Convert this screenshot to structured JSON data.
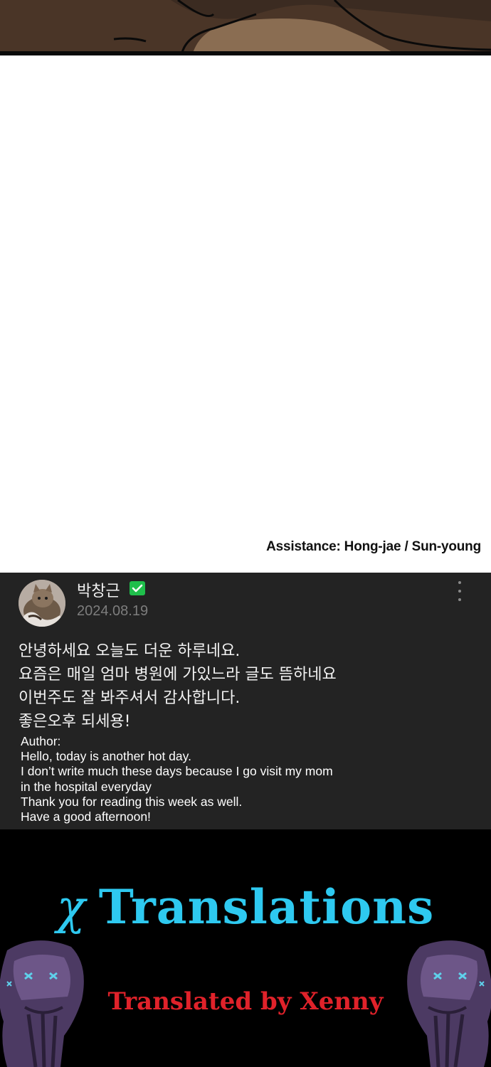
{
  "credits": {
    "text": "Assistance: Hong-jae / Sun-young"
  },
  "comment": {
    "author": "박창근",
    "date": "2024.08.19",
    "korean_lines": [
      "안녕하세요 오늘도 더운 하루네요.",
      "요즘은 매일 엄마 병원에 가있느라 글도 뜸하네요",
      "이번주도 잘 봐주셔서 감사합니다.",
      "좋은오후 되세용!"
    ],
    "english_lines": [
      "Author:",
      "Hello, today is another hot day.",
      "I don’t write much these days because I go visit my mom",
      "in the hospital everyday",
      "Thank you for reading this week as well.",
      "Have a good afternoon!"
    ],
    "icons": {
      "verified": "verified-check-icon",
      "more": "more-vertical-icon"
    },
    "colors": {
      "card_bg": "#232323",
      "verified": "#1fbf4b",
      "date": "#7d7d7d"
    }
  },
  "banner": {
    "logo_glyph": "χ",
    "title": "Translations",
    "subtitle": "Translated by Xenny",
    "colors": {
      "title": "#2ec9f0",
      "subtitle": "#e0222a",
      "bg": "#000000"
    }
  }
}
